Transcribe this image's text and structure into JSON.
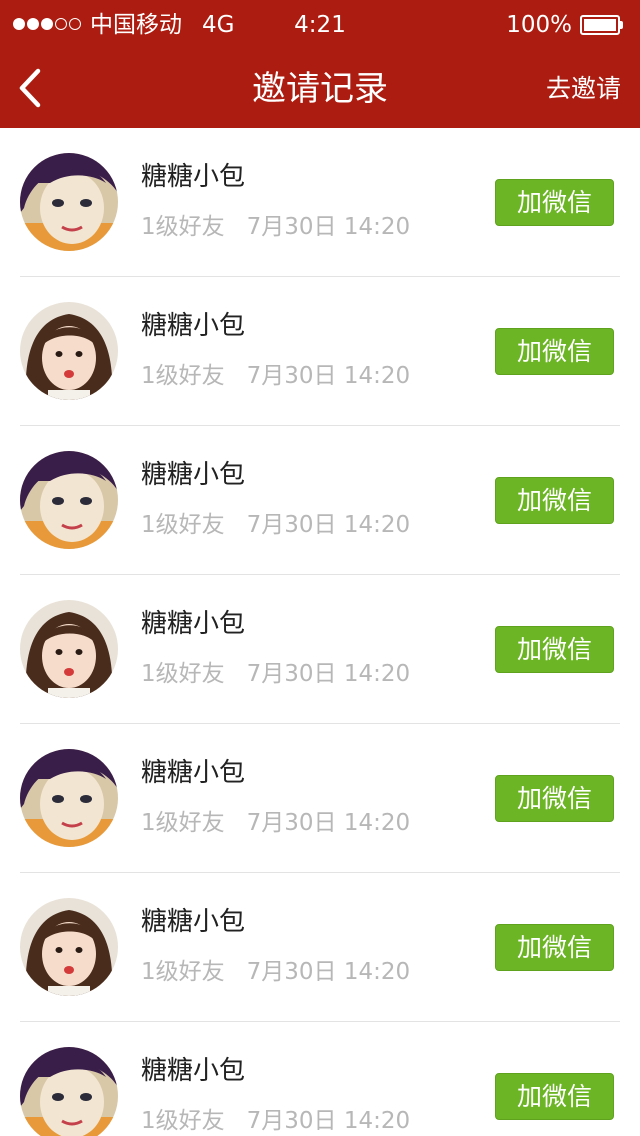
{
  "status_bar": {
    "signal_dots_filled": 3,
    "signal_dots_total": 5,
    "carrier": "中国移动",
    "network": "4G",
    "time": "4:21",
    "battery_percent": "100%",
    "battery_level": 1.0
  },
  "header": {
    "back_icon": "chevron-left-icon",
    "title": "邀请记录",
    "action_label": "去邀请",
    "background_color": "#ac1c10"
  },
  "records": [
    {
      "name": "糖糖小包",
      "level": "1级好友",
      "time": "7月30日 14:20",
      "button_label": "加微信",
      "avatar": "avatar-a"
    },
    {
      "name": "糖糖小包",
      "level": "1级好友",
      "time": "7月30日 14:20",
      "button_label": "加微信",
      "avatar": "avatar-b"
    },
    {
      "name": "糖糖小包",
      "level": "1级好友",
      "time": "7月30日 14:20",
      "button_label": "加微信",
      "avatar": "avatar-a"
    },
    {
      "name": "糖糖小包",
      "level": "1级好友",
      "time": "7月30日 14:20",
      "button_label": "加微信",
      "avatar": "avatar-b"
    },
    {
      "name": "糖糖小包",
      "level": "1级好友",
      "time": "7月30日 14:20",
      "button_label": "加微信",
      "avatar": "avatar-a"
    },
    {
      "name": "糖糖小包",
      "level": "1级好友",
      "time": "7月30日 14:20",
      "button_label": "加微信",
      "avatar": "avatar-b"
    },
    {
      "name": "糖糖小包",
      "level": "1级好友",
      "time": "7月30日 14:20",
      "button_label": "加微信",
      "avatar": "avatar-a"
    }
  ],
  "colors": {
    "button_green": "#6cb525",
    "meta_gray": "#b7b7b7",
    "divider": "#e3e3e3"
  }
}
